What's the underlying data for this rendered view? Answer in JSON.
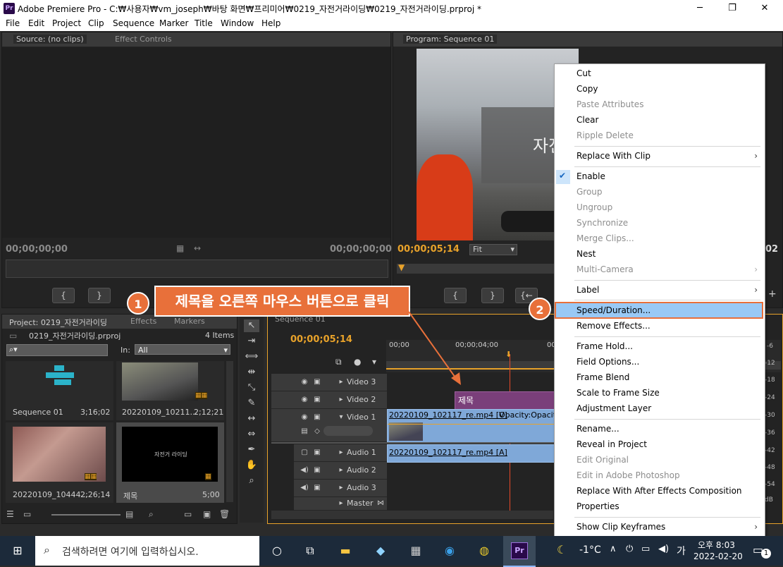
{
  "window": {
    "app_icon": "Pr",
    "title": "Adobe Premiere Pro - C:₩사용자₩vm_joseph₩바탕 화면₩프리미어₩0219_자전거라이딩₩0219_자전거라이딩.prproj *",
    "min": "─",
    "max": "❐",
    "close": "✕"
  },
  "menu": [
    "File",
    "Edit",
    "Project",
    "Clip",
    "Sequence",
    "Marker",
    "Title",
    "Window",
    "Help"
  ],
  "source": {
    "tab1": "Source: (no clips)",
    "tab2": "Effect Controls",
    "tc_left": "00;00;00;00",
    "tc_right": "00;00;00;00"
  },
  "program": {
    "tab": "Program: Sequence 01",
    "tc": "00;00;05;14",
    "fit": "Fit",
    "tc_right_partial": "02",
    "overlay_text": "자전"
  },
  "project": {
    "tab1": "Project: 0219_자전거라이딩",
    "tab2": "Effects",
    "tab3": "Markers",
    "filename": "0219_자전거라이딩.prproj",
    "count": "4 Items",
    "in_label": "In:",
    "in_value": "All",
    "items": [
      {
        "name": "Sequence 01",
        "dur": "3;16;02"
      },
      {
        "name": "20220109_10211...",
        "dur": "2;12;21"
      },
      {
        "name": "20220109_10444...",
        "dur": "2;26;14"
      },
      {
        "name": "제목",
        "dur": "5;00",
        "thumb_text": "자전거 라이딩"
      }
    ]
  },
  "timeline": {
    "tab": "Sequence 01",
    "tc": "00;00;05;14",
    "ruler": [
      "00;00",
      "00;00;04;00",
      "00;"
    ],
    "tracks": [
      {
        "name": "Video 3"
      },
      {
        "name": "Video 2"
      },
      {
        "name": "Video 1"
      },
      {
        "name": "Audio 1"
      },
      {
        "name": "Audio 2"
      },
      {
        "name": "Audio 3"
      },
      {
        "name": "Master"
      }
    ],
    "clip_title": "제목",
    "clip_video": "20220109_102117_re.mp4 [V]",
    "clip_opacity": "Opacity:Opacit",
    "clip_audio": "20220109_102117_re.mp4 [A]",
    "meter": [
      "-6",
      "-12",
      "-18",
      "-24",
      "-30",
      "-36",
      "-42",
      "-48",
      "-54",
      "dB"
    ]
  },
  "context_menu": [
    {
      "label": "Cut",
      "disabled": false
    },
    {
      "label": "Copy",
      "disabled": false
    },
    {
      "label": "Paste Attributes",
      "disabled": true
    },
    {
      "label": "Clear",
      "disabled": false
    },
    {
      "label": "Ripple Delete",
      "disabled": true
    },
    {
      "label": "Replace With Clip",
      "disabled": false
    },
    {
      "label": "Enable",
      "disabled": false
    },
    {
      "label": "Group",
      "disabled": true
    },
    {
      "label": "Ungroup",
      "disabled": true
    },
    {
      "label": "Synchronize",
      "disabled": true
    },
    {
      "label": "Merge Clips...",
      "disabled": true
    },
    {
      "label": "Nest",
      "disabled": false
    },
    {
      "label": "Multi-Camera",
      "disabled": true
    },
    {
      "label": "Label",
      "disabled": false
    },
    {
      "label": "Speed/Duration...",
      "disabled": false
    },
    {
      "label": "Remove Effects...",
      "disabled": false
    },
    {
      "label": "Frame Hold...",
      "disabled": false
    },
    {
      "label": "Field Options...",
      "disabled": false
    },
    {
      "label": "Frame Blend",
      "disabled": false
    },
    {
      "label": "Scale to Frame Size",
      "disabled": false
    },
    {
      "label": "Adjustment Layer",
      "disabled": false
    },
    {
      "label": "Rename...",
      "disabled": false
    },
    {
      "label": "Reveal in Project",
      "disabled": false
    },
    {
      "label": "Edit Original",
      "disabled": true
    },
    {
      "label": "Edit in Adobe Photoshop",
      "disabled": true
    },
    {
      "label": "Replace With After Effects Composition",
      "disabled": false
    },
    {
      "label": "Properties",
      "disabled": false
    },
    {
      "label": "Show Clip Keyframes",
      "disabled": false
    }
  ],
  "callouts": {
    "step1_num": "1",
    "step1_text": "제목을 오른쪽 마우스 버튼으로 클릭",
    "step2_num": "2"
  },
  "taskbar": {
    "search_placeholder": "검색하려면 여기에 입력하십시오.",
    "weather": "-1°C",
    "ime": "가",
    "time": "오후 8:03",
    "date": "2022-02-20",
    "notif": "1"
  },
  "colors": {
    "accent": "#e8703a",
    "highlight": "#99c9f5",
    "timecode": "#e8a22a",
    "title_clip": "#7a3f7a",
    "video_clip": "#7fa8d8"
  }
}
